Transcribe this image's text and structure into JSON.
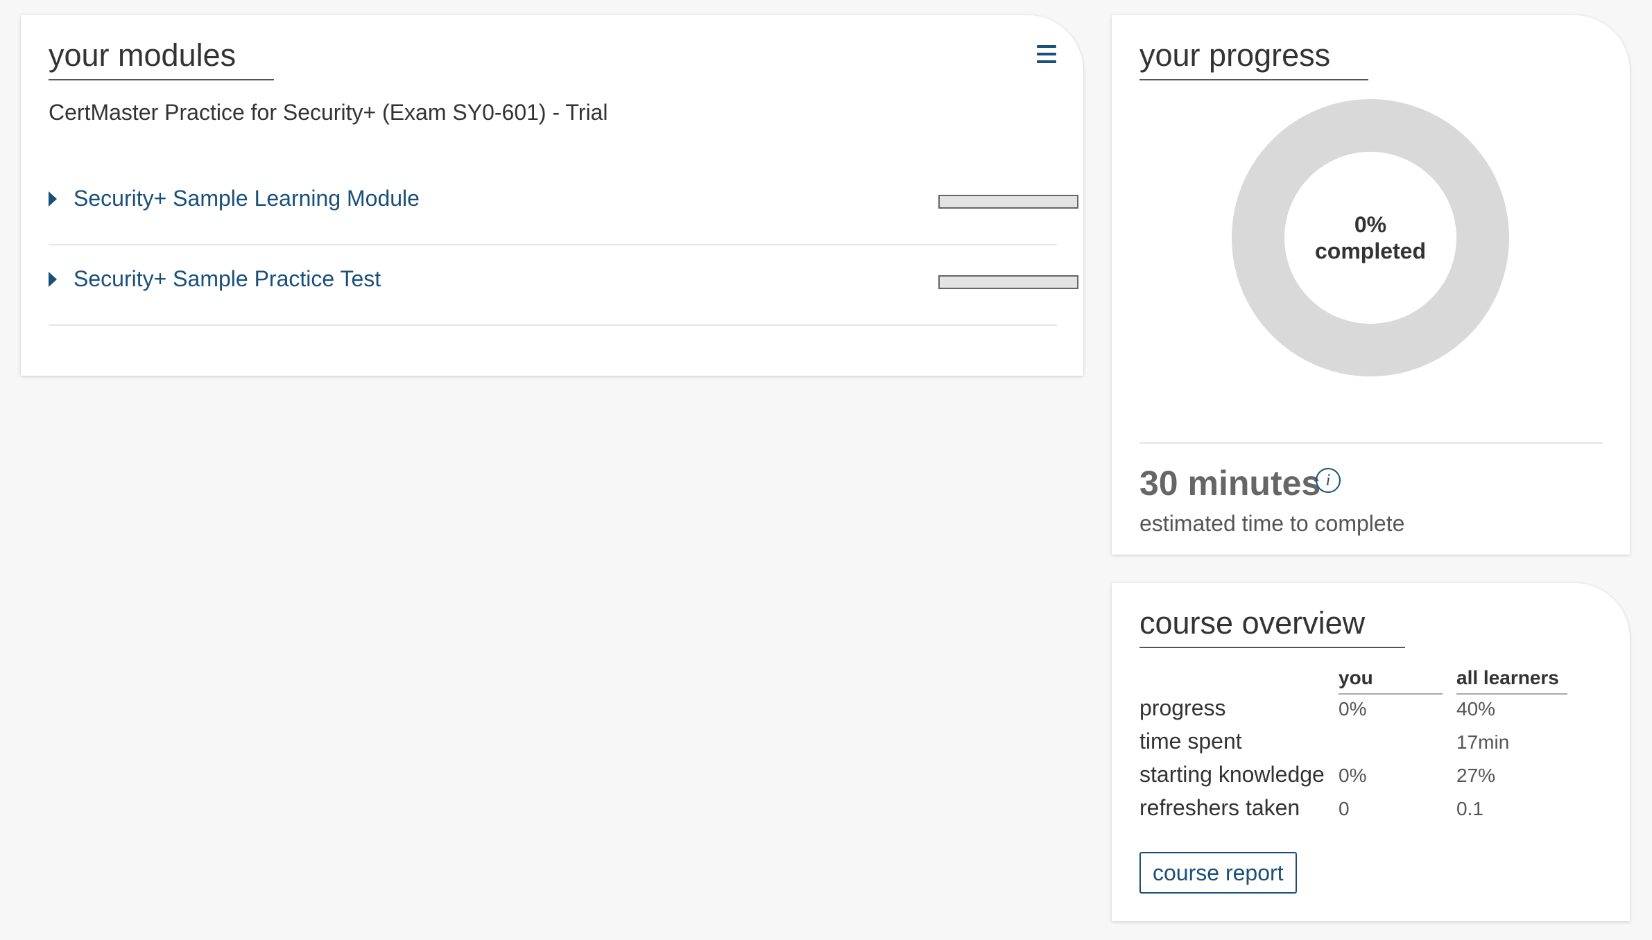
{
  "modules": {
    "title": "your modules",
    "course_name": "CertMaster Practice for Security+ (Exam SY0-601) - Trial",
    "items": [
      {
        "label": "Security+ Sample Learning Module",
        "progress": 0
      },
      {
        "label": "Security+ Sample Practice Test",
        "progress": 0
      }
    ]
  },
  "progress": {
    "title": "your progress",
    "percent": 0,
    "percent_label": "0%",
    "completed_label": "completed",
    "estimated_time": "30 minutes",
    "estimated_caption": "estimated time to complete",
    "info_icon_glyph": "i"
  },
  "overview": {
    "title": "course overview",
    "col_you": "you",
    "col_all": "all learners",
    "rows": [
      {
        "label": "progress",
        "you": "0%",
        "all": "40%"
      },
      {
        "label": "time spent",
        "you": "",
        "all": "17min"
      },
      {
        "label": "starting knowledge",
        "you": "0%",
        "all": "27%"
      },
      {
        "label": "refreshers taken",
        "you": "0",
        "all": "0.1"
      }
    ],
    "button_label": "course report"
  },
  "colors": {
    "accent": "#1a4f7a",
    "donut_track": "#d9d9d9",
    "background": "#f7f7f7"
  },
  "icons": [
    "menu-icon",
    "caret-right-icon",
    "info-icon"
  ]
}
